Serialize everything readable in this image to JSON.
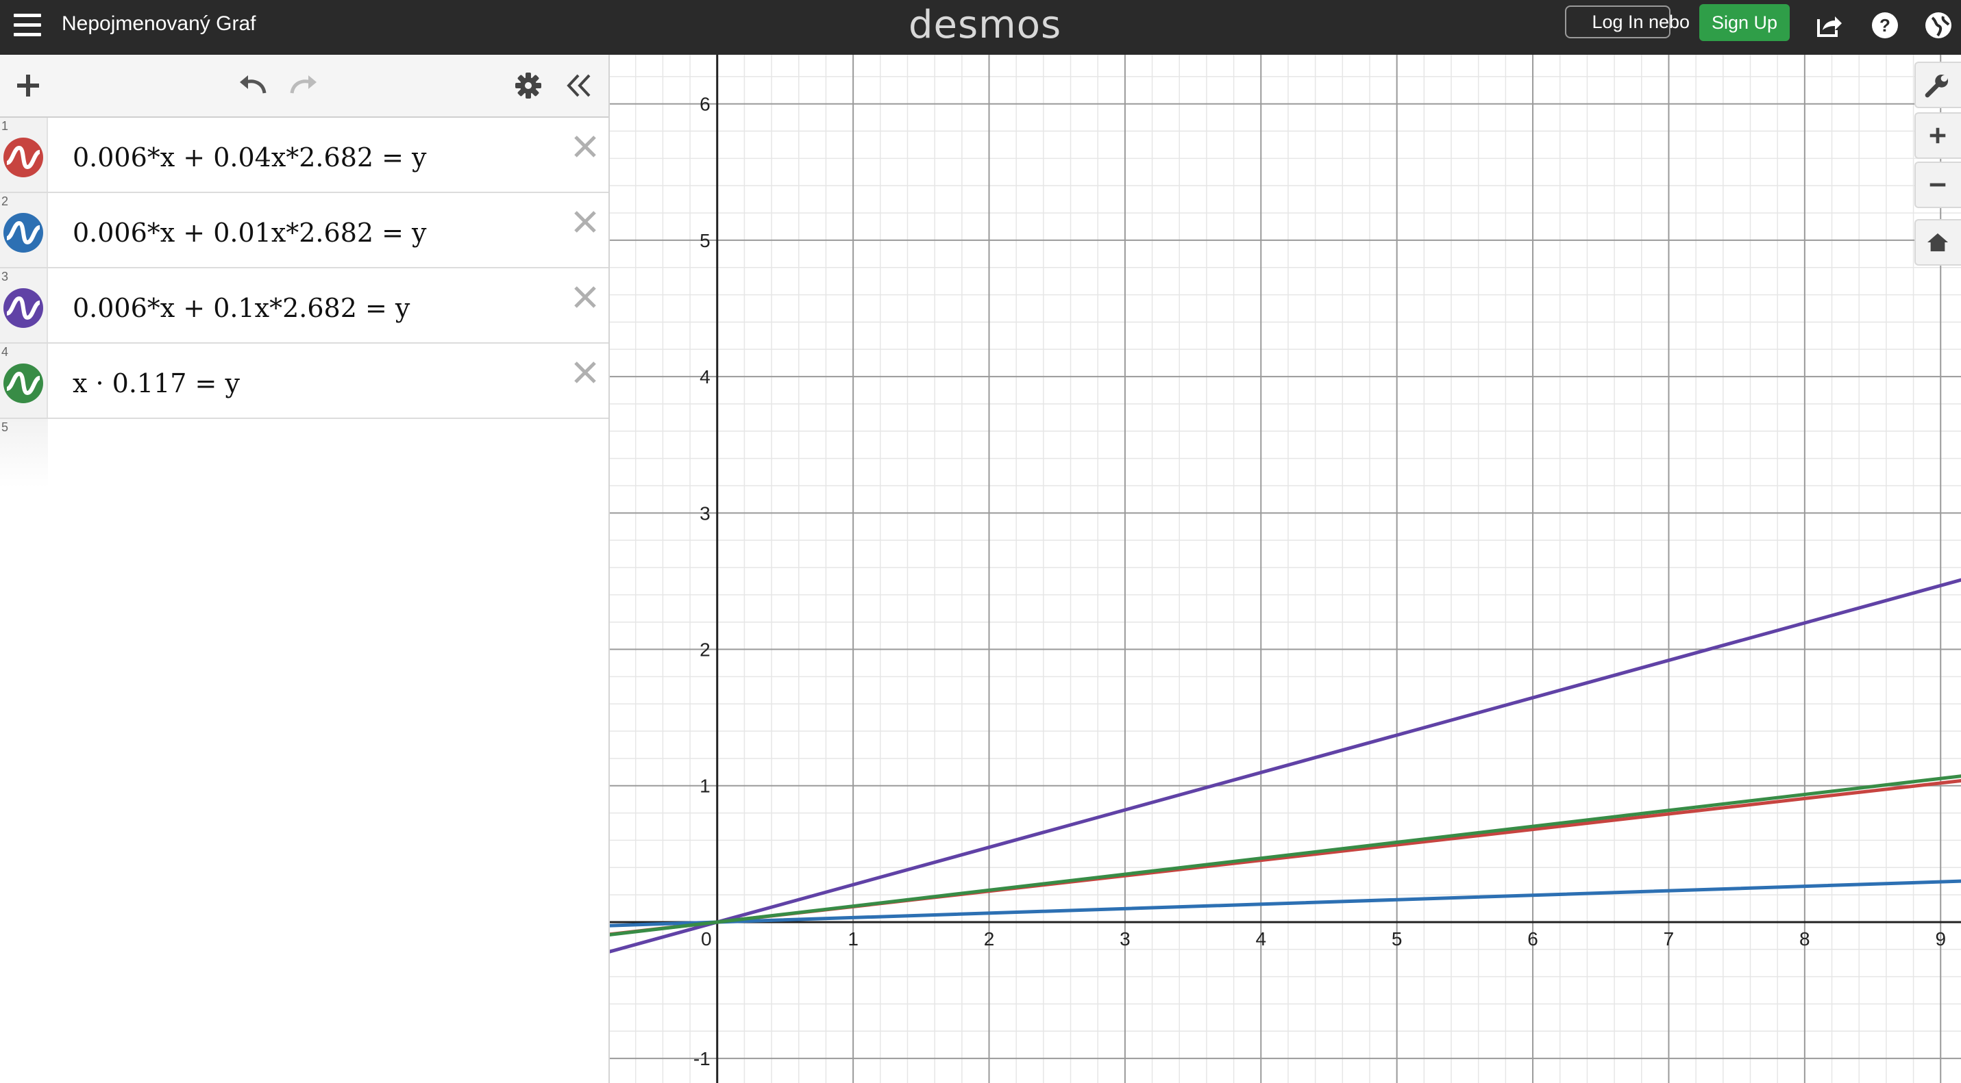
{
  "header": {
    "title": "Nepojmenovaný Graf",
    "logo": "desmos",
    "login_label": "Log In",
    "or_label": "nebo",
    "signup_label": "Sign Up",
    "icons": [
      "menu-icon",
      "share-icon",
      "help-icon",
      "language-icon"
    ]
  },
  "toolbar": {
    "icons": [
      "add-icon",
      "undo-icon",
      "redo-icon",
      "settings-icon",
      "collapse-icon"
    ]
  },
  "expressions": [
    {
      "num": "1",
      "latex": "0.006*x + 0.04x*2.682 = y",
      "color": "#c74440"
    },
    {
      "num": "2",
      "latex": "0.006*x + 0.01x*2.682 = y",
      "color": "#2d70b3"
    },
    {
      "num": "3",
      "latex": "0.006*x + 0.1x*2.682 = y",
      "color": "#6042a6"
    },
    {
      "num": "4",
      "latex": "x · 0.117 = y",
      "color": "#388c46"
    },
    {
      "num": "5",
      "latex": "",
      "color": ""
    }
  ],
  "graph_tools": [
    "wrench-icon",
    "zoom-in-icon",
    "zoom-out-icon",
    "home-icon"
  ],
  "chart_data": {
    "type": "line",
    "xlim": [
      -0.79,
      9.15
    ],
    "ylim": [
      -1.18,
      6.36
    ],
    "grid": true,
    "x_ticks": [
      "0",
      "1",
      "2",
      "3",
      "4",
      "5",
      "6",
      "7",
      "8",
      "9"
    ],
    "y_ticks": [
      "-1",
      "1",
      "2",
      "3",
      "4",
      "5",
      "6"
    ],
    "series": [
      {
        "formula": "0.006*x + 0.04x*2.682 = y",
        "slope": 0.11328,
        "color": "#c74440"
      },
      {
        "formula": "0.006*x + 0.01x*2.682 = y",
        "slope": 0.03282,
        "color": "#2d70b3"
      },
      {
        "formula": "0.006*x + 0.1x*2.682 = y",
        "slope": 0.2742,
        "color": "#6042a6"
      },
      {
        "formula": "x · 0.117 = y",
        "slope": 0.117,
        "color": "#388c46"
      }
    ]
  }
}
